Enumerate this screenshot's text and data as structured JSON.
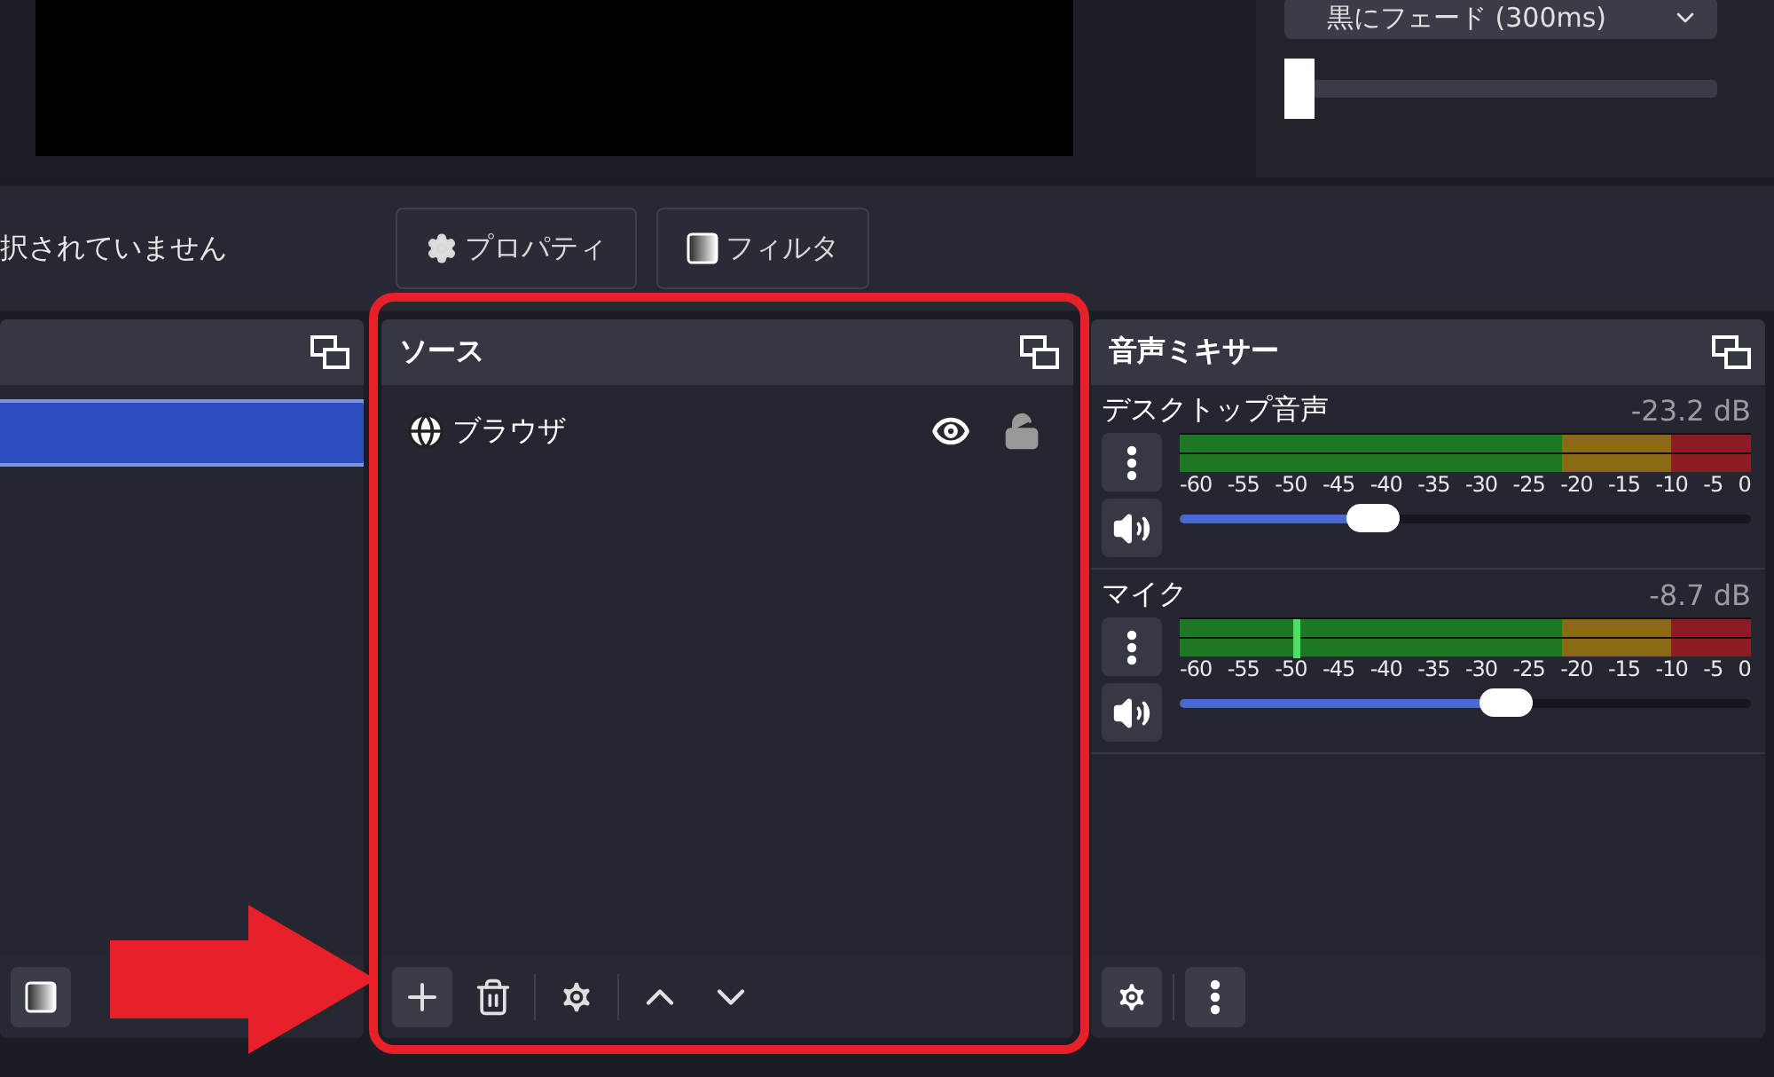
{
  "preview": {
    "transition": {
      "value": "黒にフェード (300ms)"
    },
    "duration_slider": {
      "level": 0.0
    }
  },
  "context_bar": {
    "status": "択されていません",
    "buttons": [
      {
        "kind": "properties",
        "label": "プロパティ"
      },
      {
        "kind": "filters",
        "label": "フィルタ"
      }
    ]
  },
  "scenes": {
    "items": [
      {
        "selected": true
      }
    ]
  },
  "sources": {
    "title": "ソース",
    "items": [
      {
        "name": "ブラウザ",
        "visible": true,
        "locked": false
      }
    ]
  },
  "mixer": {
    "title": "音声ミキサー",
    "channels": [
      {
        "name": "デスクトップ音声",
        "reading": "-23.2 dB",
        "level": 0.34,
        "peak_marker": false,
        "scale": [
          "-60",
          "-55",
          "-50",
          "-45",
          "-40",
          "-35",
          "-30",
          "-25",
          "-20",
          "-15",
          "-10",
          "-5",
          "0"
        ]
      },
      {
        "name": "マイク",
        "reading": "-8.7 dB",
        "level": 0.57,
        "peak_marker": true,
        "scale": [
          "-60",
          "-55",
          "-50",
          "-45",
          "-40",
          "-35",
          "-30",
          "-25",
          "-20",
          "-15",
          "-10",
          "-5",
          "0"
        ]
      }
    ]
  },
  "highlight_frame": {
    "color": "#e8202a"
  },
  "pointer_arrow": {
    "color": "#e8202a"
  }
}
